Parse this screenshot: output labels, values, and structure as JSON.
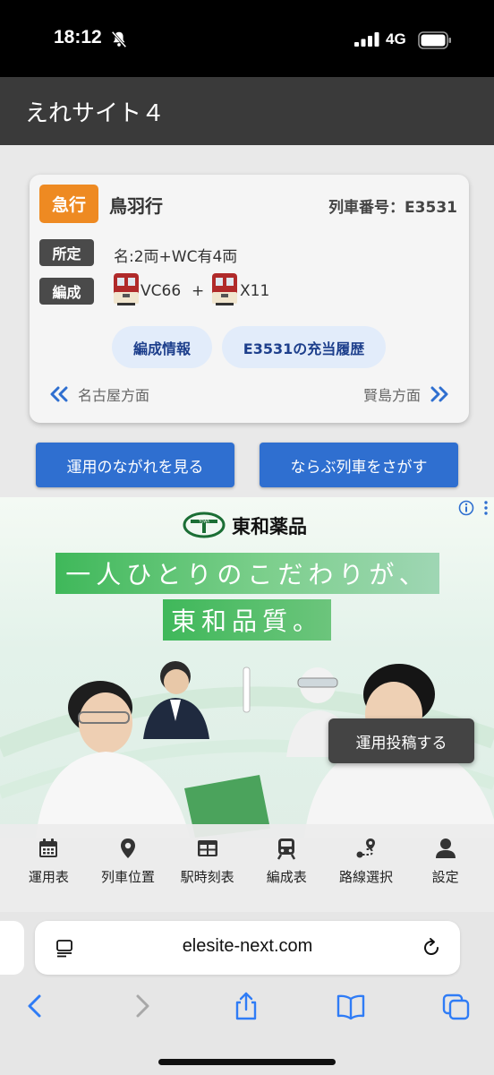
{
  "status_bar": {
    "time": "18:12",
    "network": "4G"
  },
  "header": {
    "title": "えれサイト４"
  },
  "train": {
    "type": "急行",
    "destination": "鳥羽行",
    "number_label": "列車番号：E3531",
    "assigned_label": "所定",
    "assigned_value": "名:2両+WC有4両",
    "formation_label": "編成",
    "cars": [
      "VC66",
      "X11"
    ],
    "plus": "+",
    "buttons": {
      "formation_info": "編成情報",
      "history": "E3531の充当履歴"
    },
    "direction_left": "名古屋方面",
    "direction_right": "賢島方面"
  },
  "actions": {
    "flow": "運用のながれを見る",
    "search": "ならぶ列車をさがす"
  },
  "ad": {
    "brand": "東和薬品",
    "logo_text": "TOWA",
    "slogan_line1": "一人ひとりのこだわりが、",
    "slogan_line2": "東和品質。"
  },
  "post_button": "運用投稿する",
  "tabs": [
    {
      "label": "運用表",
      "icon": "calendar-icon"
    },
    {
      "label": "列車位置",
      "icon": "location-pin-icon"
    },
    {
      "label": "駅時刻表",
      "icon": "table-icon"
    },
    {
      "label": "編成表",
      "icon": "train-icon"
    },
    {
      "label": "路線選択",
      "icon": "route-icon"
    },
    {
      "label": "設定",
      "icon": "user-icon"
    }
  ],
  "browser": {
    "url": "elesite-next.com"
  },
  "colors": {
    "accent": "#2f6fd0",
    "badge_orange": "#ee8a22",
    "header": "#3a3a3a"
  }
}
